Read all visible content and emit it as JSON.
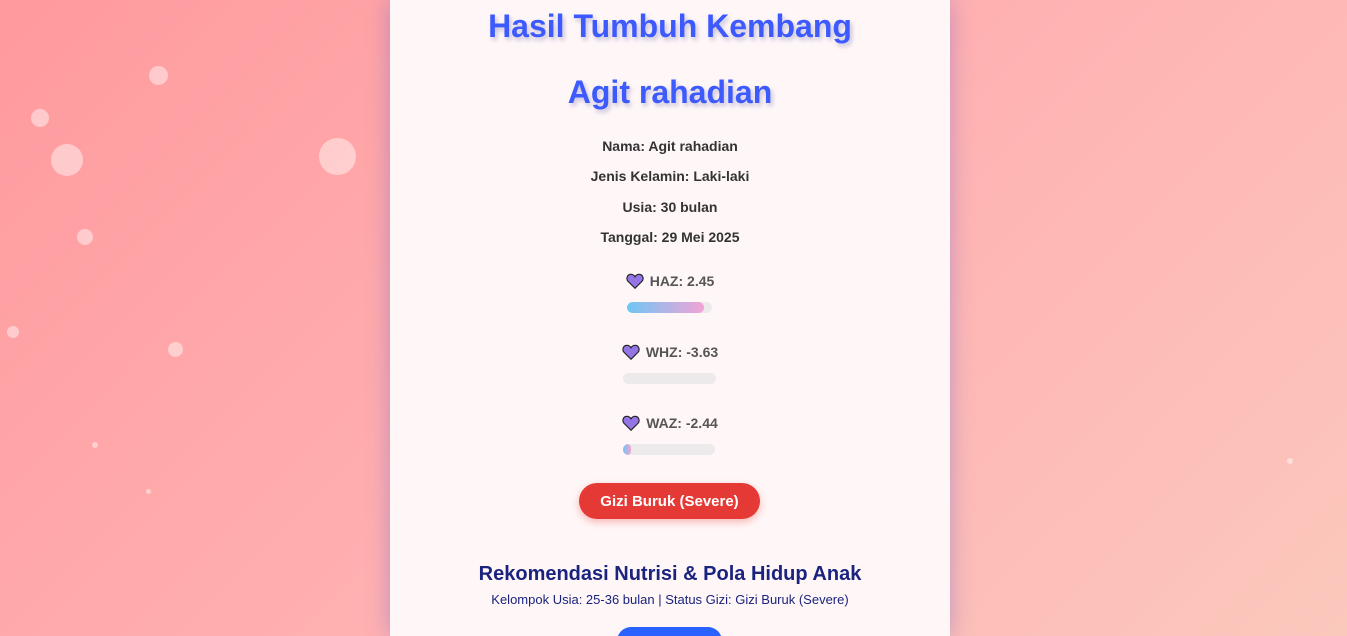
{
  "header": {
    "title": "Hasil Tumbuh Kembang",
    "child_name": "Agit rahadian"
  },
  "info": {
    "nama": "Nama: Agit rahadian",
    "jenis_kelamin": "Jenis Kelamin: Laki-laki",
    "usia": "Usia: 30 bulan",
    "tanggal": "Tanggal: 29 Mei 2025"
  },
  "metrics": [
    {
      "label": "HAZ: 2.45",
      "icon": "heart-icon",
      "progress": 0.9
    },
    {
      "label": "WHZ: -3.63",
      "icon": "heart-icon",
      "progress": 0.0
    },
    {
      "label": "WAZ: -2.44",
      "icon": "heart-icon",
      "progress": 0.09
    }
  ],
  "status": {
    "label": "Gizi Buruk (Severe)",
    "color": "#e53935"
  },
  "recommendation": {
    "title": "Rekomendasi Nutrisi & Pola Hidup Anak",
    "subtitle": "Kelompok Usia: 25-36 bulan | Status Gizi: Gizi Buruk (Severe)"
  },
  "colors": {
    "accent": "#3d5afe",
    "heart": "#9575e6",
    "bar_start": "#6ec6f5",
    "bar_end": "#f3a3d6"
  }
}
